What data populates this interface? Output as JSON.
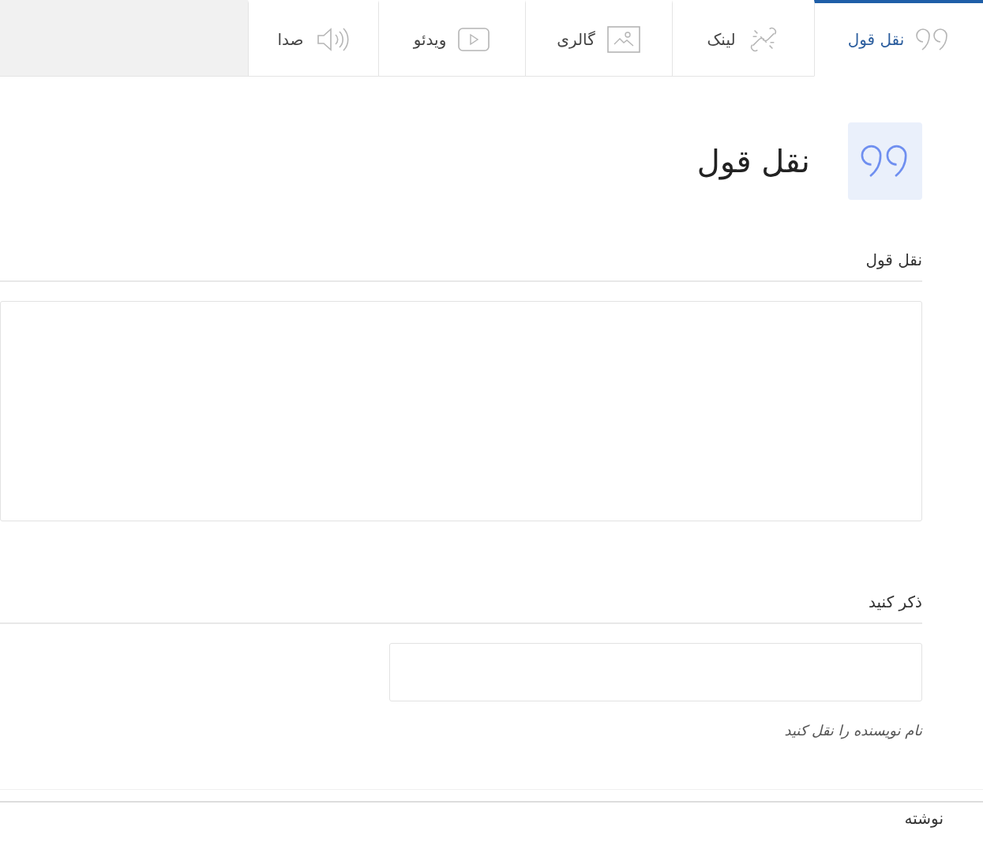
{
  "tabs": [
    {
      "kind": "quote",
      "label": "نقل قول",
      "selected": true
    },
    {
      "kind": "link",
      "label": "لینک",
      "selected": false
    },
    {
      "kind": "gallery",
      "label": "گالری",
      "selected": false
    },
    {
      "kind": "video",
      "label": "ویدئو",
      "selected": false
    },
    {
      "kind": "audio",
      "label": "صدا",
      "selected": false
    }
  ],
  "header": {
    "title": "نقل قول"
  },
  "quote_field": {
    "label": "نقل قول"
  },
  "author_field": {
    "label": "ذکر کنید",
    "hint": "نام نویسنده را نقل کنید"
  },
  "footer": {
    "label": "نوشته"
  }
}
